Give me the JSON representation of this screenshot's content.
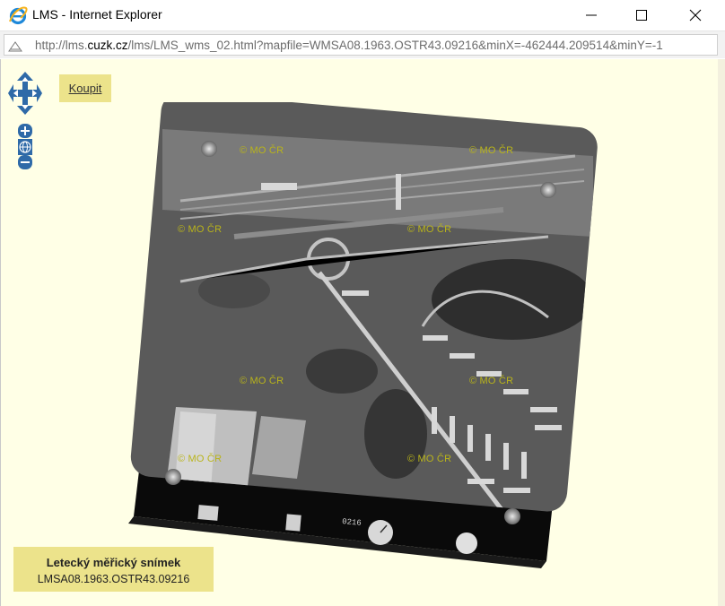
{
  "window": {
    "title": "LMS - Internet Explorer",
    "url_prefix": "http://lms.",
    "url_domain": "cuzk.cz",
    "url_rest": "/lms/LMS_wms_02.html?mapfile=WMSA08.1963.OSTR43.09216&minX=-462444.209514&minY=-1"
  },
  "map": {
    "buy_label": "Koupit",
    "watermark": "© MO ČR",
    "film_number": "0216"
  },
  "info": {
    "title": "Letecký měřický snímek",
    "id": "LMSA08.1963.OSTR43.09216"
  },
  "colors": {
    "viewport_bg": "#ffffe6",
    "panel_bg": "#ece38b",
    "watermark": "#b9b41a",
    "nav_blue": "#2f6aa8"
  },
  "icons": [
    "ie-logo-icon",
    "minimize-icon",
    "maximize-icon",
    "close-icon",
    "page-icon",
    "pan-arrows-icon",
    "zoom-in-icon",
    "globe-icon",
    "zoom-out-icon"
  ]
}
